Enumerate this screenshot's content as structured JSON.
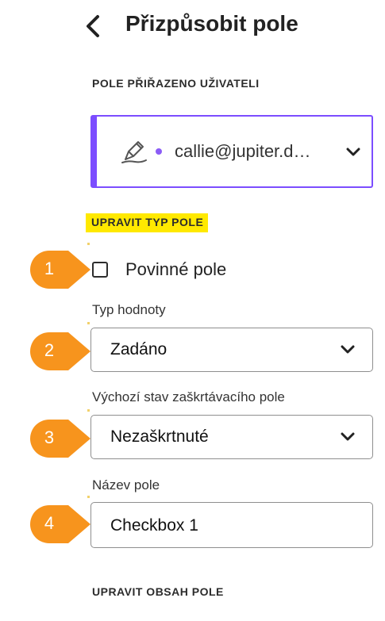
{
  "header": {
    "title": "Přizpůsobit pole",
    "back_icon": "chevron-left-icon"
  },
  "assignee": {
    "section_label": "POLE PŘIŘAZENO UŽIVATELI",
    "email": "callie@jupiter.d…",
    "dot_color": "#8b5cf6",
    "accent_color": "#7c4dff"
  },
  "edit_type": {
    "section_label": "UPRAVIT TYP POLE",
    "highlight_color": "#ffe900",
    "required_label": "Povinné pole",
    "required_checked": false,
    "value_type": {
      "label": "Typ hodnoty",
      "value": "Zadáno"
    },
    "default_state": {
      "label": "Výchozí stav zaškrtávacího pole",
      "value": "Nezaškrtnuté"
    },
    "field_name": {
      "label": "Název pole",
      "value": "Checkbox 1"
    }
  },
  "edit_content": {
    "section_label": "UPRAVIT OBSAH POLE"
  },
  "callouts": [
    {
      "number": "1",
      "color": "#f7941d"
    },
    {
      "number": "2",
      "color": "#f7941d"
    },
    {
      "number": "3",
      "color": "#f7941d"
    },
    {
      "number": "4",
      "color": "#f7941d"
    }
  ]
}
